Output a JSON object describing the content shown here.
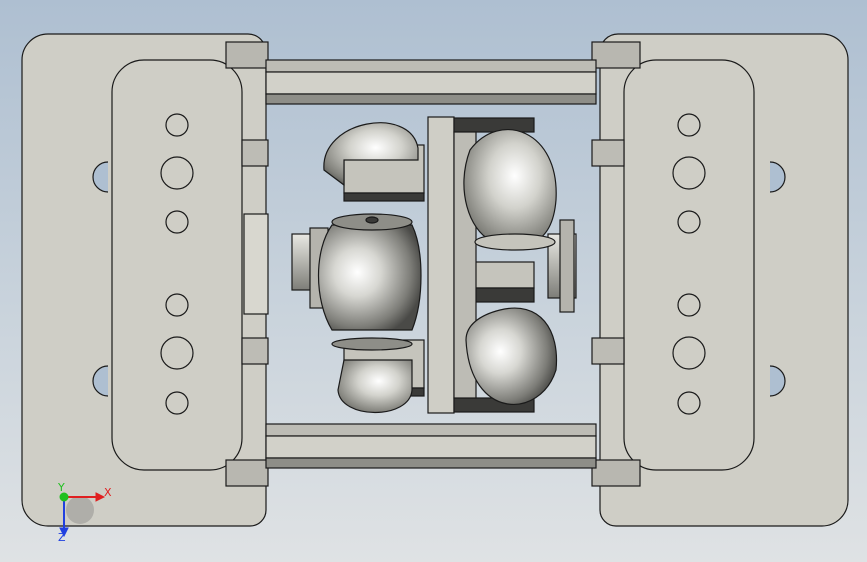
{
  "viewport": {
    "background_top": "#aebfd1",
    "background_bottom": "#dfe2e4",
    "part_fill": "#cfcec6",
    "edge_color": "#1a1a1a",
    "shadow_fill": "#8e8e88"
  },
  "triad": {
    "x_label": "X",
    "y_label": "Y",
    "z_label": "Z",
    "x_color": "#e02020",
    "y_color": "#20c020",
    "z_color": "#2040e0"
  }
}
